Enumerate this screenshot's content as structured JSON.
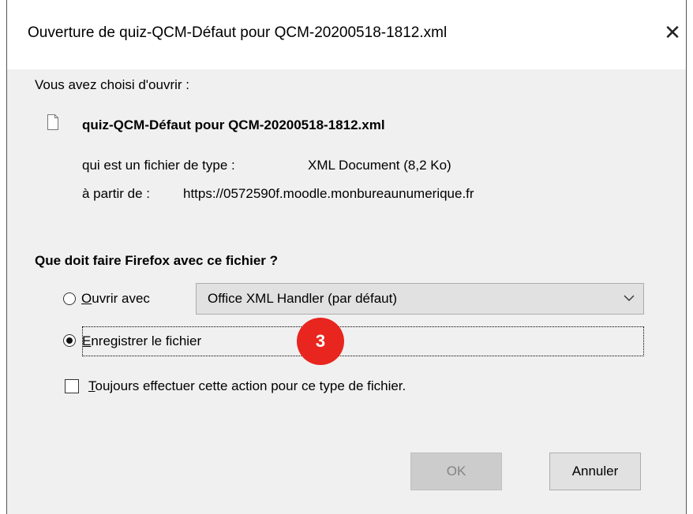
{
  "window": {
    "title": "Ouverture de quiz-QCM-Défaut pour QCM-20200518-1812.xml",
    "close_icon": "close-icon"
  },
  "intro": "Vous avez choisi d'ouvrir :",
  "file": {
    "name": "quiz-QCM-Défaut pour QCM-20200518-1812.xml",
    "type_label": "qui est un fichier de type :",
    "type_value": "XML Document (8,2 Ko)",
    "source_label": "à partir de :",
    "source_value": "https://0572590f.moodle.monbureaunumerique.fr"
  },
  "question": "Que doit faire Firefox avec ce fichier ?",
  "options": {
    "open_with": {
      "label_first": "O",
      "label_rest": "uvrir avec",
      "checked": false
    },
    "handler_selected": "Office XML Handler (par défaut)",
    "save": {
      "label_first": "E",
      "label_rest": "nregistrer le fichier",
      "checked": true
    }
  },
  "always": {
    "label_first": "T",
    "label_rest": "oujours effectuer cette action pour ce type de fichier.",
    "checked": false
  },
  "step_badge": "3",
  "buttons": {
    "ok": "OK",
    "cancel": "Annuler"
  },
  "colors": {
    "badge": "#e8251f",
    "content_bg": "#f0f0f0"
  }
}
